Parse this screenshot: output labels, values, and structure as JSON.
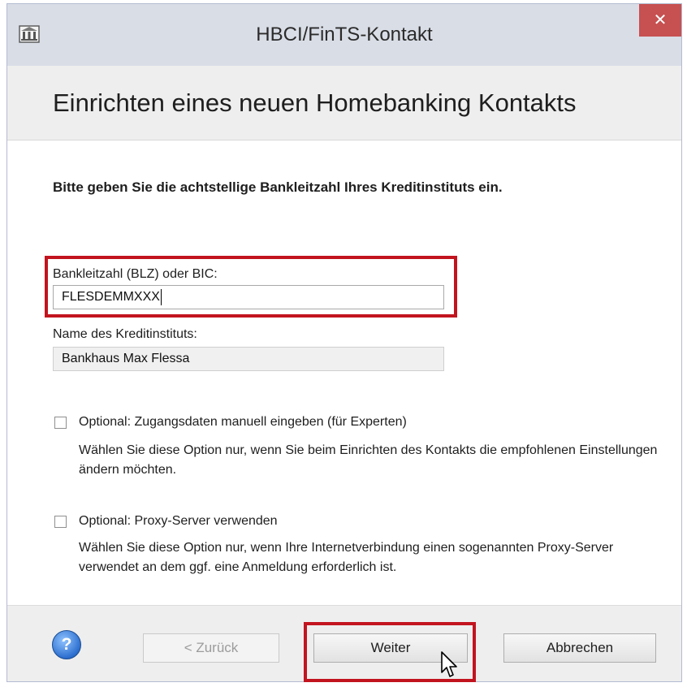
{
  "window": {
    "title": "HBCI/FinTS-Kontakt",
    "close_glyph": "✕"
  },
  "header": {
    "title": "Einrichten eines neuen Homebanking Kontakts"
  },
  "main": {
    "instruction": "Bitte geben Sie die achtstellige Bankleitzahl Ihres Kreditinstituts ein.",
    "blz_label": "Bankleitzahl (BLZ) oder BIC:",
    "blz_value": "FLESDEMMXXX",
    "bank_name_label": "Name des Kreditinstituts:",
    "bank_name_value": "Bankhaus Max Flessa",
    "options": [
      {
        "label": "Optional: Zugangsdaten manuell eingeben (für Experten)",
        "description": "Wählen Sie diese Option nur, wenn Sie beim Einrichten des Kontakts die empfohlenen Einstellungen ändern möchten.",
        "checked": false
      },
      {
        "label": "Optional: Proxy-Server verwenden",
        "description": "Wählen Sie diese Option nur, wenn Ihre Internetverbindung einen sogenannten Proxy-Server verwendet an dem ggf. eine Anmeldung erforderlich ist.",
        "checked": false
      }
    ]
  },
  "footer": {
    "help_glyph": "?",
    "back_label": "< Zurück",
    "next_label": "Weiter",
    "cancel_label": "Abbrechen"
  },
  "colors": {
    "highlight": "#c2141f",
    "titlebar": "#d9dde6",
    "close_button": "#c75050"
  }
}
